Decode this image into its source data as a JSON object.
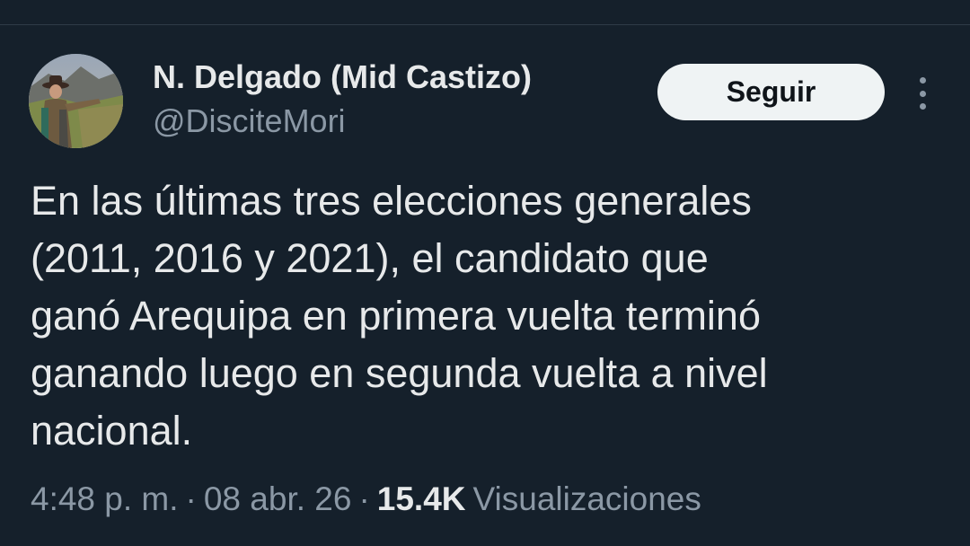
{
  "tweet": {
    "author": {
      "display_name": "N. Delgado (Mid Castizo)",
      "handle": "@DisciteMori",
      "avatar_icon": "profile-photo"
    },
    "follow_label": "Seguir",
    "more_icon": "more-options-icon",
    "text_lines": [
      "En las últimas tres elecciones generales",
      "(2011, 2016 y 2021), el candidato que",
      "ganó Arequipa en primera vuelta terminó",
      "ganando luego en segunda vuelta a nivel",
      "nacional."
    ],
    "time": "4:48 p. m.",
    "date": "08 abr. 26",
    "separator": "·",
    "views_count": "15.4K",
    "views_label": "Visualizaciones"
  },
  "colors": {
    "background": "#15202b",
    "primary_text": "#e7e9ea",
    "secondary_text": "#8b98a5",
    "follow_button_bg": "#eff3f4",
    "follow_button_text": "#0f1419"
  }
}
